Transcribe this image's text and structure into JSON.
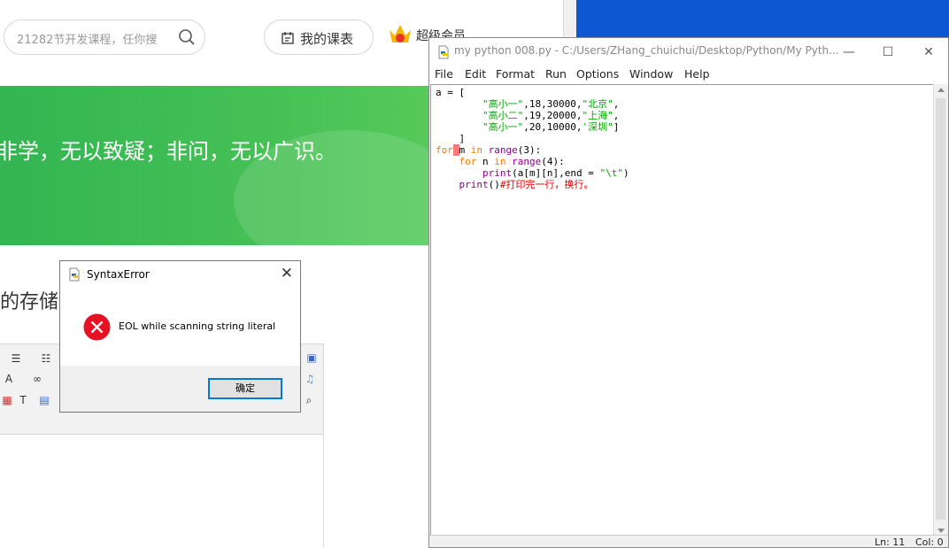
{
  "web": {
    "search_placeholder": "21282节开发课程，任你搜",
    "course_button": "我的课表",
    "vip_label": "超级会员",
    "banner_quote": "非学，无以致疑；非问，无以广识。",
    "section_title": "的存储"
  },
  "idle": {
    "title": "my python 008.py - C:/Users/ZHang_chuichui/Desktop/Python/My Pyth...",
    "window_buttons": {
      "minimize": "—",
      "maximize": "☐",
      "close": "✕"
    },
    "menu": [
      "File",
      "Edit",
      "Format",
      "Run",
      "Options",
      "Window",
      "Help"
    ],
    "status": {
      "line": "Ln: 11",
      "col": "Col: 0"
    },
    "code": {
      "l1": "a = [",
      "l2_str1": "\"高小一\"",
      "l2_rest": ",18,30000,",
      "l2_str2": "\"北京\"",
      "l3_str1": "\"高小二\"",
      "l3_rest": ",19,20000,",
      "l3_str2": "\"上海\"",
      "l4_str1": "\"高小一\"",
      "l4_rest": ",20,10000,",
      "l4_str2": "'深圳\"",
      "l5": "]",
      "l6_kw": "for",
      "l6_var": "m ",
      "l6_in": "in",
      "l6_fn": "range",
      "l6_rest": "(3):",
      "l7_kw": "for",
      "l7_var": " n ",
      "l7_in": "in",
      "l7_fn": "range",
      "l7_rest": "(4):",
      "l8_fn": "print",
      "l8_rest": "(a[m][n],end = ",
      "l8_str": "\"\\t\"",
      "l8_end": ")",
      "l9_fn": "print",
      "l9_rest": "()",
      "l9_comment": "#打印完一行，换行。"
    }
  },
  "dialog": {
    "title": "SyntaxError",
    "message": "EOL while scanning string literal",
    "ok_label": "确定",
    "close_glyph": "✕"
  },
  "colors": {
    "banner_green": "#3dbb54",
    "keyword": "#ff7700",
    "builtin": "#900090",
    "string": "#00aa00",
    "comment": "#dd0000",
    "error_icon": "#e81123",
    "desktop_blue": "#0d58d2"
  }
}
